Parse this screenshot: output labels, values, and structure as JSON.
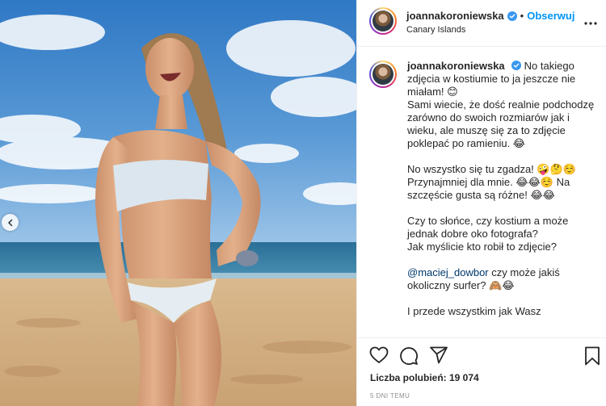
{
  "post": {
    "username": "joannakoroniewska",
    "follow_label": "Obserwuj",
    "separator": "•",
    "location": "Canary Islands",
    "caption": "No takiego zdjęcia w kostiumie to ja jeszcze nie miałam! 😊\nSami wiecie, że dość realnie podchodzę zarówno do swoich rozmiarów jak i wieku, ale muszę się za to zdjęcie poklepać po ramieniu. 😂\n\nNo wszystko się tu zgadza! 🤪🤔☺️ Przynajmniej dla mnie. 😂😂☺️ Na szczęście gusta są różne! 😂😂\n\nCzy to słońce, czy kostium a może jednak dobre oko fotografa?\nJak myślicie kto robił to zdjęcie?\n\n",
    "mention": "@maciej_dowbor",
    "caption_after_mention": " czy może jakiś okoliczny surfer? 🙈😂\n\nI przede wszystkim jak Wasz",
    "likes": "Liczba polubień: 19 074",
    "timestamp": "5 DNI TEMU"
  },
  "icons": {
    "verified": "verified-badge-icon",
    "more": "more-options-icon",
    "like": "heart-icon",
    "comment": "comment-icon",
    "share": "share-icon",
    "save": "bookmark-icon",
    "prev": "chevron-left-icon"
  },
  "colors": {
    "link": "#0095f6",
    "mention": "#00376b",
    "border": "#efefef"
  }
}
